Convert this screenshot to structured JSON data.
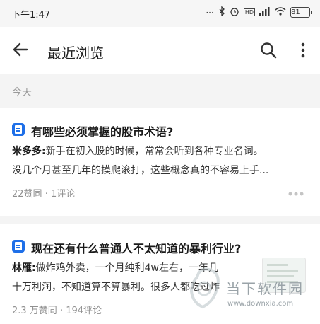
{
  "status_bar": {
    "time": "下午1:47",
    "battery": "81",
    "network_hd": "HD"
  },
  "app_bar": {
    "title": "最近浏览"
  },
  "section": {
    "label": "今天"
  },
  "items": [
    {
      "question": "有哪些必须掌握的股市术语?",
      "author": "米多多:",
      "answer_line1": "新手在初入股的时候，常常会听到各种专业名词。",
      "answer_line2": "没几个月甚至几年的摸爬滚打，这些概念真的不容易上手...",
      "likes": "22赞同",
      "sep": "·",
      "comments": "1评论"
    },
    {
      "question": "现在还有什么普通人不太知道的暴利行业?",
      "author": "林雁:",
      "answer_line1": "做炸鸡外卖，一个月纯利4w左右，一年几",
      "answer_line2": "十万利润，不知道算不算暴利。很多人都吃过炸",
      "likes": "2.3 万赞同",
      "sep": "·",
      "comments": "194评论"
    }
  ],
  "watermark": {
    "text": "当下软件园",
    "url": "www.downxia.com"
  }
}
